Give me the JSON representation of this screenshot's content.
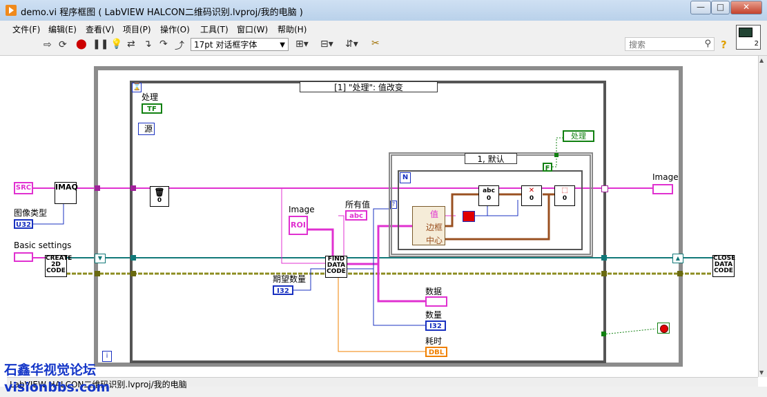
{
  "window": {
    "title": "demo.vi 程序框图 ( LabVIEW HALCON二维码识别.lvproj/我的电脑 )",
    "min_label": "—",
    "max_label": "□",
    "close_label": "✕"
  },
  "menu": {
    "items": [
      "文件(F)",
      "编辑(E)",
      "查看(V)",
      "项目(P)",
      "操作(O)",
      "工具(T)",
      "窗口(W)",
      "帮助(H)"
    ]
  },
  "toolbar": {
    "font": "17pt 对话框字体",
    "search_placeholder": "搜索",
    "help": "?",
    "vi_icon_number": "2"
  },
  "diagram": {
    "case_selector": "[1] \"处理\": 值改变",
    "inner_case_selector": "1, 默认",
    "labels": {
      "chuli": "处理",
      "tf": "TF",
      "yuan": "源",
      "src": "SRC",
      "imaq": "IMAQ",
      "image_type": "图像类型",
      "u32": "U32",
      "basic_settings": "Basic  settings",
      "create": "CREATE 2D CODE",
      "image_in": "Image",
      "roi": "ROI",
      "all_values": "所有值",
      "abc": "abc",
      "find": "FIND DATA CODE",
      "expected_count": "期望数量",
      "i32": "I32",
      "data": "数据",
      "count": "数量",
      "time": "耗时",
      "dbl": "DBL",
      "value": "值",
      "edge": "边框",
      "center": "中心",
      "n": "N",
      "chuli_local": "处理",
      "f_const": "F",
      "image_out": "Image",
      "close": "CLOSE DATA CODE",
      "iter": "i",
      "zero": "0"
    }
  },
  "status": {
    "path": "LabVIEW HALCON二维码识别.lvproj/我的电脑"
  },
  "watermark": {
    "line1": "石鑫华视觉论坛",
    "line2": "visionbbs.com"
  },
  "colors": {
    "pink_wire": "#e030d0",
    "blue_wire": "#1830c0",
    "olive_wire": "#8c8c20",
    "teal_wire": "#107878",
    "orange_wire": "#f08000",
    "green_wire": "#108010",
    "brown_wire": "#9a5020"
  }
}
